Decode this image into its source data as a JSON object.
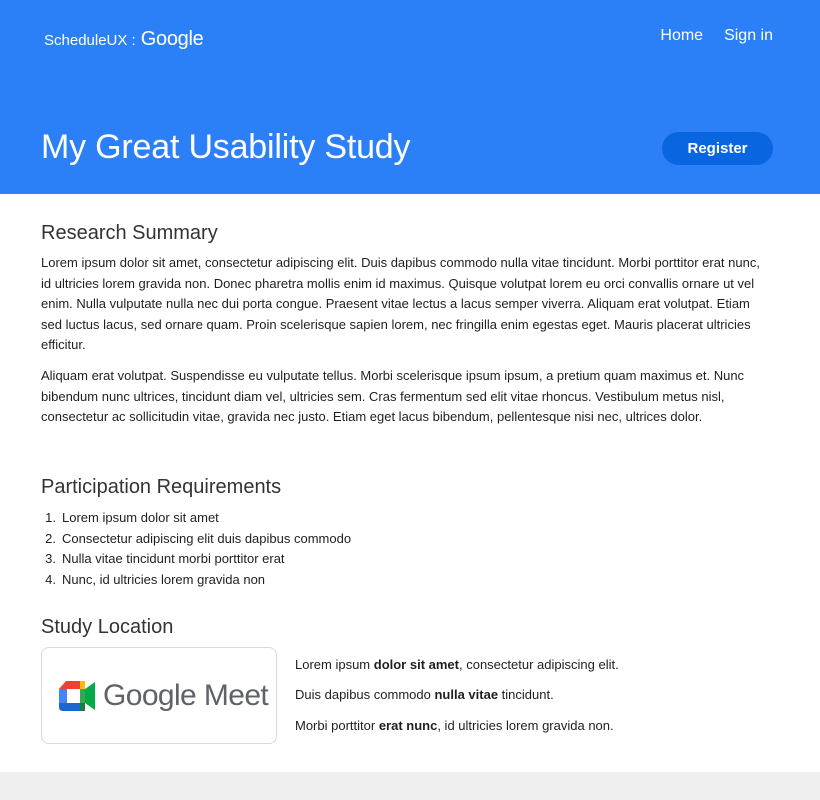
{
  "header": {
    "brand_prefix": "ScheduleUX :",
    "brand_name": "Google",
    "nav": [
      "Home",
      "Sign in"
    ],
    "title": "My Great Usability Study",
    "register_label": "Register"
  },
  "summary": {
    "title": "Research Summary",
    "paragraphs": [
      "Lorem ipsum dolor sit amet, consectetur adipiscing elit. Duis dapibus commodo nulla vitae tincidunt. Morbi porttitor erat nunc, id ultricies lorem gravida non. Donec pharetra mollis enim id maximus. Quisque volutpat lorem eu orci convallis ornare ut vel enim. Nulla vulputate nulla nec dui porta congue. Praesent vitae lectus a lacus semper viverra. Aliquam erat volutpat. Etiam sed luctus lacus, sed ornare quam. Proin scelerisque sapien lorem, nec fringilla enim egestas eget. Mauris placerat ultricies efficitur.",
      "Aliquam erat volutpat. Suspendisse eu vulputate tellus. Morbi scelerisque ipsum ipsum, a pretium quam maximus et. Nunc bibendum nunc ultrices, tincidunt diam vel, ultricies sem. Cras fermentum sed elit vitae rhoncus. Vestibulum metus nisl, consectetur ac sollicitudin vitae, gravida nec justo. Etiam eget lacus bibendum, pellentesque nisi nec, ultrices dolor."
    ]
  },
  "requirements": {
    "title": "Participation Requirements",
    "items": [
      {
        "num": "1.",
        "text": "Lorem ipsum dolor sit amet"
      },
      {
        "num": "2.",
        "text": "Consectetur adipiscing elit duis dapibus commodo"
      },
      {
        "num": "3.",
        "text": "Nulla vitae tincidunt morbi porttitor erat"
      },
      {
        "num": "4.",
        "text": "Nunc, id ultricies lorem gravida non"
      }
    ]
  },
  "location": {
    "title": "Study Location",
    "logo_text": "Google Meet",
    "logo_icon": "google-meet-icon",
    "lines": [
      {
        "before": "Lorem ipsum ",
        "bold": "dolor sit amet",
        "after": ", consectetur adipiscing elit."
      },
      {
        "before": "Duis dapibus commodo ",
        "bold": "nulla vitae",
        "after": " tincidunt."
      },
      {
        "before": "Morbi porttitor ",
        "bold": "erat nunc",
        "after": ", id ultricies lorem gravida non."
      }
    ]
  },
  "colors": {
    "header_bg": "#2b80f7",
    "register_bg": "#0a66e0",
    "footer_bg": "#efefef"
  }
}
